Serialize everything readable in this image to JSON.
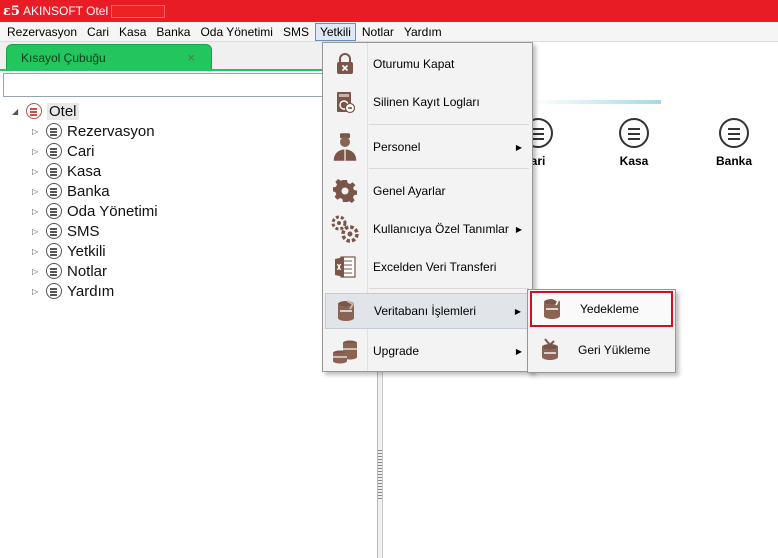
{
  "window": {
    "title": "AKINSOFT Otel"
  },
  "menubar": {
    "items": [
      "Rezervasyon",
      "Cari",
      "Kasa",
      "Banka",
      "Oda Yönetimi",
      "SMS",
      "Yetkili",
      "Notlar",
      "Yardım"
    ],
    "active": "Yetkili"
  },
  "tab": {
    "label": "Kısayol Çubuğu",
    "close": "×"
  },
  "search": {
    "value": ""
  },
  "tree": {
    "root": "Otel",
    "children": [
      "Rezervasyon",
      "Cari",
      "Kasa",
      "Banka",
      "Oda Yönetimi",
      "SMS",
      "Yetkili",
      "Notlar",
      "Yardım"
    ]
  },
  "shortcuts": [
    {
      "label": "ari",
      "icon": "list-icon"
    },
    {
      "label": "Kasa",
      "icon": "list-icon"
    },
    {
      "label": "Banka",
      "icon": "list-icon"
    }
  ],
  "dropdown": {
    "items": [
      {
        "label": "Oturumu Kapat",
        "icon": "lock-icon",
        "submenu": false
      },
      {
        "label": "Silinen Kayıt Logları",
        "icon": "log-icon",
        "submenu": false
      },
      {
        "label": "Personel",
        "icon": "staff-icon",
        "submenu": true
      },
      {
        "label": "Genel Ayarlar",
        "icon": "gear-icon",
        "submenu": false
      },
      {
        "label": "Kullanıcıya Özel Tanımlar",
        "icon": "gears-icon",
        "submenu": true
      },
      {
        "label": "Excelden Veri Transferi",
        "icon": "excel-icon",
        "submenu": false
      },
      {
        "label": "Veritabanı İşlemleri",
        "icon": "database-icon",
        "submenu": true
      },
      {
        "label": "Upgrade",
        "icon": "upgrade-icon",
        "submenu": true
      }
    ],
    "submenu_arrow": "▶"
  },
  "submenu": {
    "items": [
      {
        "label": "Yedekleme",
        "icon": "backup-icon"
      },
      {
        "label": "Geri Yükleme",
        "icon": "restore-icon"
      }
    ]
  },
  "colors": {
    "title_bar": "#e81c24",
    "tab": "#22c55e",
    "icon_brown": "#7a5548",
    "focus_border": "#d0101e"
  }
}
